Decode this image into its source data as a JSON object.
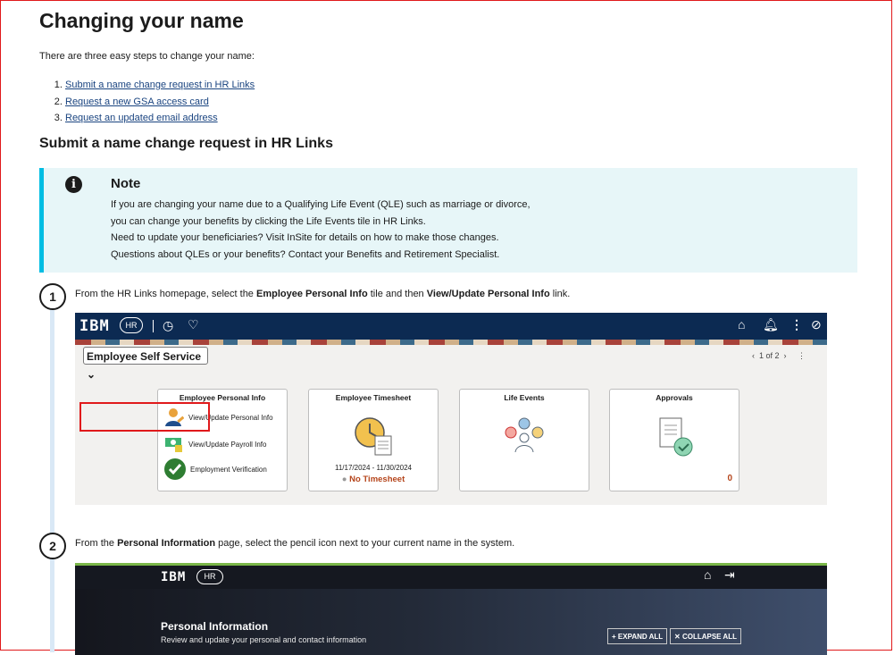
{
  "title": "Changing your name",
  "intro": "There are three easy steps to change your name:",
  "steps": [
    {
      "label": "Submit a name change request in HR Links"
    },
    {
      "label": "Request a new GSA access card"
    },
    {
      "label": "Request an updated email address"
    }
  ],
  "section_heading": "Submit a name change request in HR Links",
  "note": {
    "title": "Note",
    "lines": [
      "If you are changing your name due to a Qualifying Life Event (QLE) such as marriage or divorce,",
      "you can change your benefits by clicking the Life Events tile in HR Links.",
      "Need to update your beneficiaries? Visit InSite for details on how to make those changes.",
      "Questions about QLEs or your benefits? Contact your Benefits and Retirement Specialist."
    ]
  },
  "step1": {
    "number": "1",
    "pre": "From the HR Links homepage, select the ",
    "bold1": "Employee Personal Info",
    "mid": " tile and then ",
    "bold2": "View/Update Personal Info",
    "post": " link."
  },
  "step2": {
    "number": "2",
    "pre": "From the ",
    "bold1": "Personal Information",
    "post": " page, select the pencil icon next to your current name in the system."
  },
  "shot1": {
    "brand": "IBM",
    "hr_logo": "HR",
    "dropdown": "Employee Self Service",
    "pager": "1 of 2",
    "tiles": {
      "personal": {
        "title": "Employee Personal Info",
        "links": [
          "View/Update Personal Info",
          "View/Update Payroll Info",
          "Employment Verification"
        ]
      },
      "timesheet": {
        "title": "Employee Timesheet",
        "range": "11/17/2024 - 11/30/2024",
        "status": "No Timesheet"
      },
      "life": {
        "title": "Life Events"
      },
      "approvals": {
        "title": "Approvals",
        "count": "0"
      }
    }
  },
  "shot2": {
    "brand": "IBM",
    "hr_logo": "HR",
    "title": "Personal Information",
    "subtitle": "Review and update your personal and contact information",
    "expand": "EXPAND ALL",
    "collapse": "COLLAPSE ALL"
  },
  "colors": {
    "link": "#1a4480",
    "note_bg": "#e7f6f8",
    "note_border": "#00bde3",
    "highlight": "#e0191b"
  }
}
